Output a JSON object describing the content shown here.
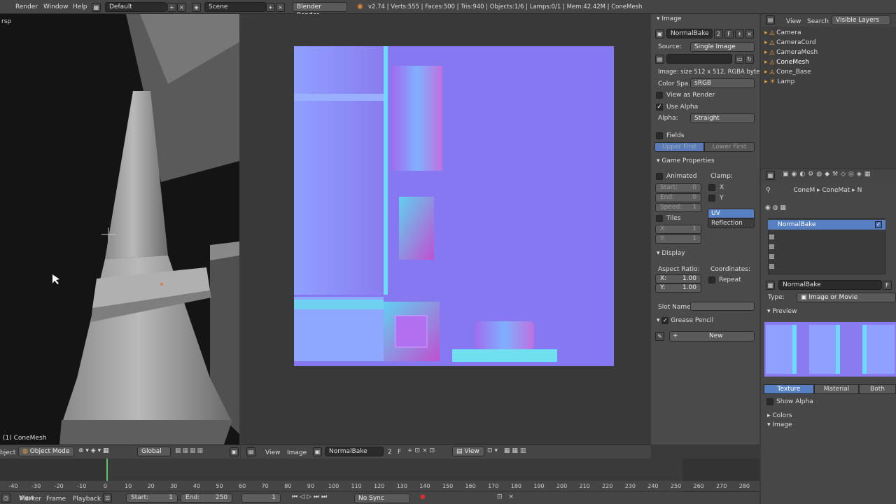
{
  "top": {
    "menus": [
      "Render",
      "Window",
      "Help"
    ],
    "layout": "Default",
    "scene": "Scene",
    "engine": "Blender Render",
    "stats": "v2.74 | Verts:555 | Faces:500 | Tris:940 | Objects:1/6 | Lamps:0/1 | Mem:42.42M | ConeMesh"
  },
  "viewport": {
    "persp": "rsp",
    "object_label": "(1) ConeMesh",
    "mode": "Object Mode",
    "orientation": "Global",
    "left_menu": "bject"
  },
  "image_editor": {
    "menu_view": "View",
    "menu_image": "Image",
    "image_name": "NormalBake",
    "users": "2",
    "fake": "F",
    "view2": "View"
  },
  "props": {
    "image_title": "Image",
    "image_name": "NormalBake",
    "users": "2",
    "fake": "F",
    "source_label": "Source:",
    "source": "Single Image",
    "info": "Image: size 512 x 512, RGBA byte",
    "colorspace_label": "Color Spa...",
    "colorspace": "sRGB",
    "view_as_render": "View as Render",
    "use_alpha": "Use Alpha",
    "alpha_label": "Alpha:",
    "alpha": "Straight",
    "fields": "Fields",
    "upper_first": "Upper First",
    "lower_first": "Lower First",
    "game_title": "Game Properties",
    "animated": "Animated",
    "clamp": "Clamp:",
    "start": "Start:",
    "start_val": "0",
    "end": "End:",
    "end_val": "0",
    "speed": "Speed:",
    "speed_val": "1",
    "cx": "X",
    "cy": "Y",
    "uv": "UV Coordinates",
    "reflection": "Reflection",
    "tiles": "Tiles",
    "tx": "X:",
    "tx_val": "1",
    "ty": "Y:",
    "ty_val": "1",
    "display_title": "Display",
    "aspect": "Aspect Ratio:",
    "coords": "Coordinates:",
    "ax": "X:",
    "ax_val": "1.00",
    "ay": "Y:",
    "ay_val": "1.00",
    "repeat": "Repeat",
    "slot_name": "Slot Name:",
    "grease_title": "Grease Pencil",
    "new_btn": "New"
  },
  "outliner": {
    "view": "View",
    "search": "Search",
    "layers": "Visible Layers",
    "items": [
      "Camera",
      "CameraCord",
      "CameraMesh",
      "ConeMesh",
      "Cone_Base",
      "Lamp"
    ]
  },
  "tex": {
    "crumbs": [
      "ConeM",
      "ConeMat",
      "N"
    ],
    "slot": "NormalBake",
    "tex_name": "NormalBake",
    "tex_f": "F",
    "type_label": "Type:",
    "type": "Image or Movie",
    "preview": "Preview",
    "tabs": [
      "Texture",
      "Material",
      "Both"
    ],
    "show_alpha": "Show Alpha",
    "colors": "Colors",
    "image": "Image"
  },
  "timeline": {
    "ticks": [
      "-40",
      "-30",
      "-20",
      "-10",
      "0",
      "10",
      "20",
      "30",
      "40",
      "50",
      "60",
      "70",
      "80",
      "90",
      "100",
      "110",
      "120",
      "130",
      "140",
      "150",
      "160",
      "170",
      "180",
      "190",
      "200",
      "210",
      "220",
      "230",
      "240",
      "250",
      "260",
      "270",
      "280"
    ],
    "menus": [
      "View",
      "Marker",
      "Frame",
      "Playback"
    ],
    "start_label": "Start:",
    "start": "1",
    "end_label": "End:",
    "end": "250",
    "current": "1",
    "sync": "No Sync"
  }
}
